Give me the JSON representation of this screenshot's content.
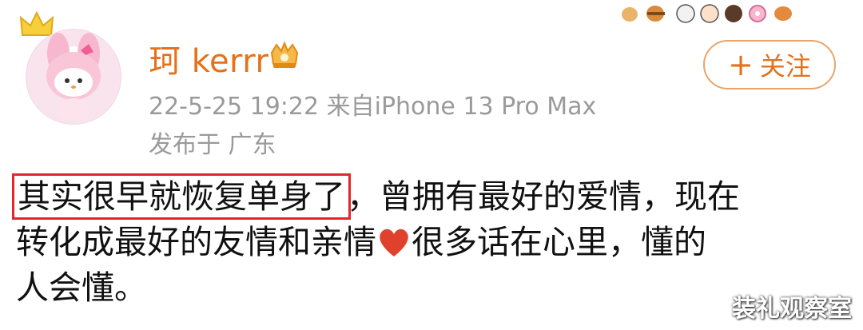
{
  "post": {
    "author": {
      "name": "珂 kerrr",
      "avatar_icon": "my-melody-avatar",
      "badge_icon": "vip-crown-icon"
    },
    "meta": {
      "timestamp_source": "22-5-25 19:22  来自iPhone 13 Pro Max",
      "location": "发布于 广东"
    },
    "follow": {
      "plus": "+",
      "label": "关注"
    },
    "content": {
      "highlighted": "其实很早就恢复单身了",
      "line1_rest": "，曾拥有最好的爱情，现在",
      "line2_a": "转化成最好的友情和亲情",
      "line2_b": "很多话在心里，懂的",
      "line3": "人会懂。"
    },
    "colors": {
      "username": "#e5711a",
      "highlight_box": "#e3262d",
      "meta_text": "#9a9a9a",
      "heart": "#e0412c"
    }
  },
  "watermark": "装礼观察室"
}
